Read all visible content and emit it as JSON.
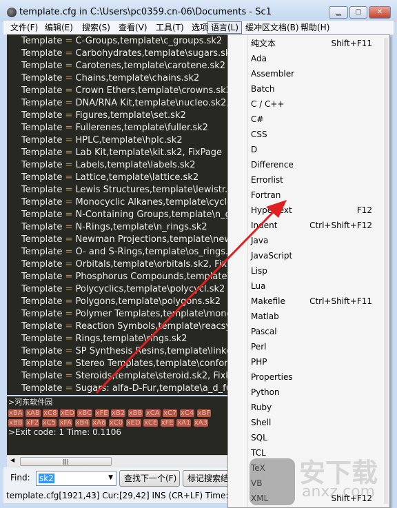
{
  "window": {
    "title": "template.cfg in C:\\Users\\pc0359.cn-06\\Documents - Sc1",
    "minimize": "▁",
    "maximize": "▢",
    "close": "✕"
  },
  "menubar": [
    "文件(F)",
    "编辑(E)",
    "搜索(S)",
    "查看(V)",
    "工具(T)",
    "选项(O)",
    "语言(L)",
    "缓冲区文档(B)",
    "帮助(H)"
  ],
  "editor": {
    "key": "Template",
    "eq": "=",
    "lines": [
      "C-Groups,template\\c_groups.sk2",
      "Carbohydrates,template\\sugars.sk2",
      "Carotenes,template\\carotene.sk2",
      "Chains,template\\chains.sk2",
      "Crown Ethers,template\\crowns.sk2",
      "DNA/RNA Kit,template\\nucleo.sk2,",
      "Figures,template\\set.sk2",
      "Fullerenes,template\\fuller.sk2",
      "HPLC,template\\hplc.sk2",
      "Lab Kit,template\\kit.sk2, FixPage",
      "Labels,template\\labels.sk2",
      "Lattice,template\\lattice.sk2",
      "Lewis Structures,template\\lewistr.sk2",
      "Monocyclic Alkanes,template\\cycloalk",
      "N-Containing Groups,template\\n_groups",
      "N-Rings,template\\n_rings.sk2",
      "Newman Projections,template\\newman",
      "O- and S-Rings,template\\os_rings.sk2",
      "Orbitals,template\\orbitals.sk2, FixPage",
      "Phosphorus Compounds,template\\phos",
      "Polycyclics,template\\polycycl.sk2",
      "Polygons,template\\polygons.sk2",
      "Polymer Templates,template\\monomer",
      "Reaction Symbols,template\\reacsym",
      "Rings,template\\rings.sk2",
      "SP Synthesis Resins,template\\linker",
      "Stereo Templates,template\\conform",
      "Steroids,template\\steroid.sk2, FixPage",
      "Sugars: alfa-D-Fur,template\\a_d_fur"
    ]
  },
  "output": {
    "line1": ">河东软件园",
    "hex1": [
      "xBA",
      "xAB",
      "xC8",
      "xED",
      "xBC",
      "xFE",
      "xB2",
      "xBB",
      "xCA",
      "xC7",
      "xC4",
      "xBF"
    ],
    "hex2": [
      "xBB",
      "xF2",
      "xC5",
      "xFA",
      "xB4",
      "xA6",
      "xC0",
      "xED",
      "xCE",
      "xFE",
      "xA1",
      "xA3"
    ],
    "exit": ">Exit code: 1    Time: 0.1106"
  },
  "find": {
    "label": "Find:",
    "value": "sk2",
    "next_button": "查找下一个(F)",
    "mark_button": "标记搜索结果"
  },
  "status": "template.cfg[1921,43] Cur:[29,42] INS (CR+LF)  Time:[20",
  "language_menu": [
    {
      "label": "纯文本",
      "shortcut": "Shift+F11"
    },
    {
      "label": "Ada"
    },
    {
      "label": "Assembler"
    },
    {
      "label": "Batch"
    },
    {
      "label": "C / C++"
    },
    {
      "label": "C#"
    },
    {
      "label": "CSS"
    },
    {
      "label": "D"
    },
    {
      "label": "Difference"
    },
    {
      "label": "Errorlist"
    },
    {
      "label": "Fortran"
    },
    {
      "label": "Hypertext",
      "shortcut": "F12"
    },
    {
      "label": "Indent",
      "shortcut": "Ctrl+Shift+F12"
    },
    {
      "label": "Java"
    },
    {
      "label": "JavaScript"
    },
    {
      "label": "Lisp"
    },
    {
      "label": "Lua"
    },
    {
      "label": "Makefile",
      "shortcut": "Ctrl+Shift+F11"
    },
    {
      "label": "Matlab"
    },
    {
      "label": "Pascal"
    },
    {
      "label": "Perl"
    },
    {
      "label": "PHP"
    },
    {
      "label": "Properties"
    },
    {
      "label": "Python"
    },
    {
      "label": "Ruby"
    },
    {
      "label": "Shell"
    },
    {
      "label": "SQL"
    },
    {
      "label": "TCL"
    },
    {
      "label": "TeX"
    },
    {
      "label": "VB"
    },
    {
      "label": "XML",
      "shortcut": "Shift+F12"
    }
  ],
  "watermark": {
    "text": "安下载",
    "url": "anxz.com"
  },
  "colors": {
    "editor_bg": "#272822",
    "operator": "#d08a2a",
    "annotation_arrow": "#e02020"
  }
}
